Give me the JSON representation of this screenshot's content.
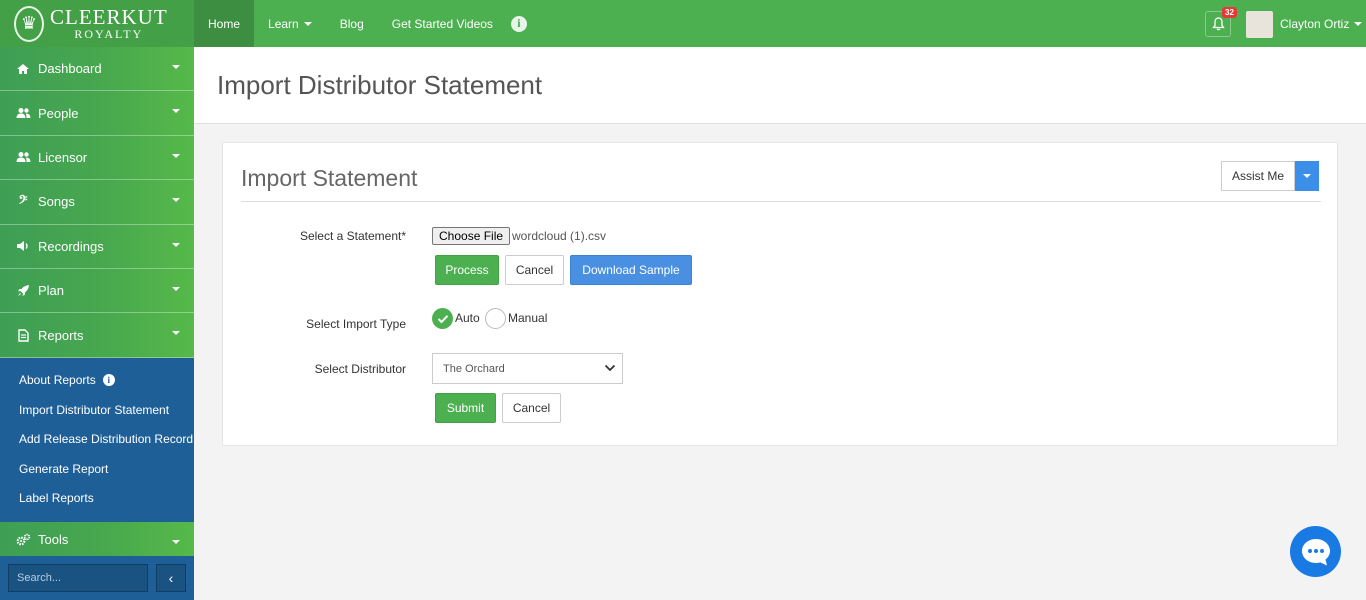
{
  "brand": {
    "name": "CLEERKUT",
    "tagline": "ROYALTY"
  },
  "topnav": {
    "items": [
      {
        "label": "Home",
        "active": true,
        "dropdown": false
      },
      {
        "label": "Learn",
        "active": false,
        "dropdown": true
      },
      {
        "label": "Blog",
        "active": false,
        "dropdown": false
      },
      {
        "label": "Get Started Videos",
        "active": false,
        "dropdown": false
      }
    ],
    "notification_count": "32",
    "user_name": "Clayton Ortiz"
  },
  "sidebar": {
    "items": [
      {
        "label": "Dashboard",
        "icon": "home-icon"
      },
      {
        "label": "People",
        "icon": "users-icon"
      },
      {
        "label": "Licensor",
        "icon": "users-icon"
      },
      {
        "label": "Songs",
        "icon": "bass-clef-icon"
      },
      {
        "label": "Recordings",
        "icon": "volume-icon"
      },
      {
        "label": "Plan",
        "icon": "rocket-icon"
      },
      {
        "label": "Reports",
        "icon": "document-icon"
      }
    ],
    "report_submenu": [
      "About Reports",
      "Import Distributor Statement",
      "Add Release Distribution Record",
      "Generate Report",
      "Label Reports"
    ],
    "tools_label": "Tools",
    "search_placeholder": "Search..."
  },
  "page": {
    "title": "Import Distributor Statement"
  },
  "card": {
    "title": "Import Statement",
    "assist_label": "Assist Me",
    "statement_label": "Select a Statement*",
    "choose_file_label": "Choose File",
    "file_name": "wordcloud (1).csv",
    "process_label": "Process",
    "cancel_label": "Cancel",
    "download_sample_label": "Download Sample",
    "import_type_label": "Select Import Type",
    "import_types": {
      "auto": "Auto",
      "manual": "Manual",
      "selected": "Auto"
    },
    "distributor_label": "Select Distributor",
    "distributor_value": "The Orchard",
    "submit_label": "Submit",
    "cancel2_label": "Cancel"
  },
  "colors": {
    "primary_green": "#4caf50",
    "sidebar_blue": "#1f5f98",
    "accent_blue": "#4a90e2",
    "badge_red": "#e53935"
  }
}
